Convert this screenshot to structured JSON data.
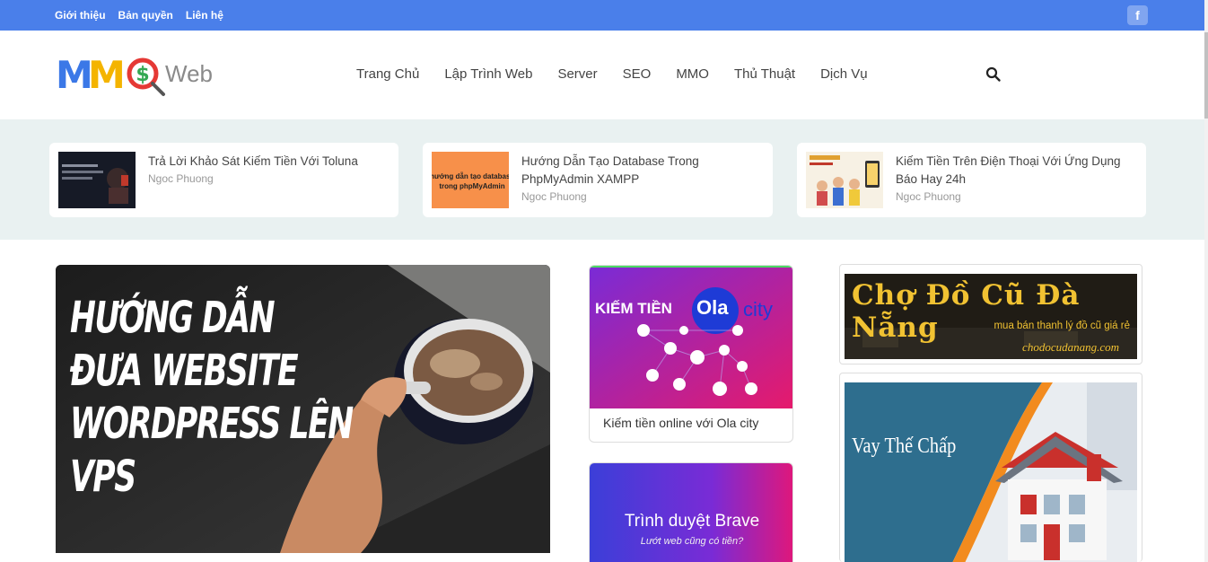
{
  "topbar": {
    "links": [
      "Giới thiệu",
      "Bản quyền",
      "Liên hệ"
    ],
    "facebook_icon": "facebook-icon",
    "color": "#4a7fea"
  },
  "header": {
    "logo": {
      "letters": [
        "M",
        "M",
        "O"
      ],
      "suffix": "Web"
    },
    "nav": [
      "Trang Chủ",
      "Lập Trình Web",
      "Server",
      "SEO",
      "MMO",
      "Thủ Thuật",
      "Dịch Vụ"
    ],
    "search_icon": "search-icon"
  },
  "featured": [
    {
      "title": "Trả Lời Khảo Sát Kiếm Tiền Với Toluna",
      "author": "Ngoc Phuong"
    },
    {
      "title": "Hướng Dẫn Tạo Database Trong PhpMyAdmin XAMPP",
      "author": "Ngoc Phuong",
      "thumb_text": "hướng dẫn tạo database trong phpMyAdmin"
    },
    {
      "title": "Kiếm Tiền Trên Điện Thoại Với Ứng Dụng Báo Hay 24h",
      "author": "Ngoc Phuong"
    }
  ],
  "main_post": {
    "image_text": [
      "HƯỚNG DẪN",
      "ĐƯA WEBSITE",
      "WORDPRESS LÊN",
      "VPS"
    ]
  },
  "side_posts": [
    {
      "image_text_left": "KIẾM TIỀN",
      "image_logo": "Ola",
      "image_logo_suffix": "city",
      "caption": "Kiếm tiền online với Ola city"
    },
    {
      "image_title": "Trình duyệt Brave",
      "image_subtitle": "Lướt web cũng có tiền?"
    }
  ],
  "ads": [
    {
      "title": "Chợ Đồ Cũ Đà Nẵng",
      "subtitle": "mua bán thanh lý đồ cũ giá rẻ",
      "url": "chodocudanang.com"
    },
    {
      "title": "Vay Thế Chấp"
    }
  ]
}
